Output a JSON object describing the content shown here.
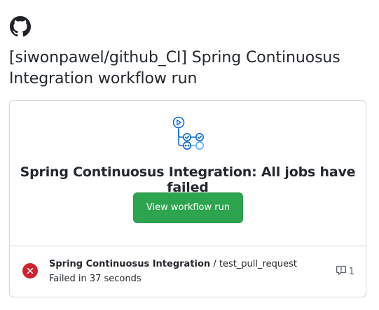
{
  "email": {
    "subject": "[siwonpawel/github_CI] Spring Continuosus Integration workflow run"
  },
  "card": {
    "headline": "Spring Continuosus Integration: All jobs have failed",
    "cta_label": "View workflow run"
  },
  "job": {
    "workflow_name": "Spring Continuosus Integration",
    "separator": " / ",
    "job_name": "test_pull_request",
    "status_text": "Failed in 37 seconds",
    "annotation_count": "1",
    "status": "failed"
  },
  "icons": {
    "logo": "github-logo-icon",
    "workflow": "workflow-graph-icon",
    "failure": "x-circle-icon",
    "annotation": "comment-alert-icon"
  },
  "colors": {
    "success_button": "#2da44e",
    "failure_red": "#cf222e",
    "workflow_blue": "#0969da",
    "border": "#d0d7de"
  }
}
